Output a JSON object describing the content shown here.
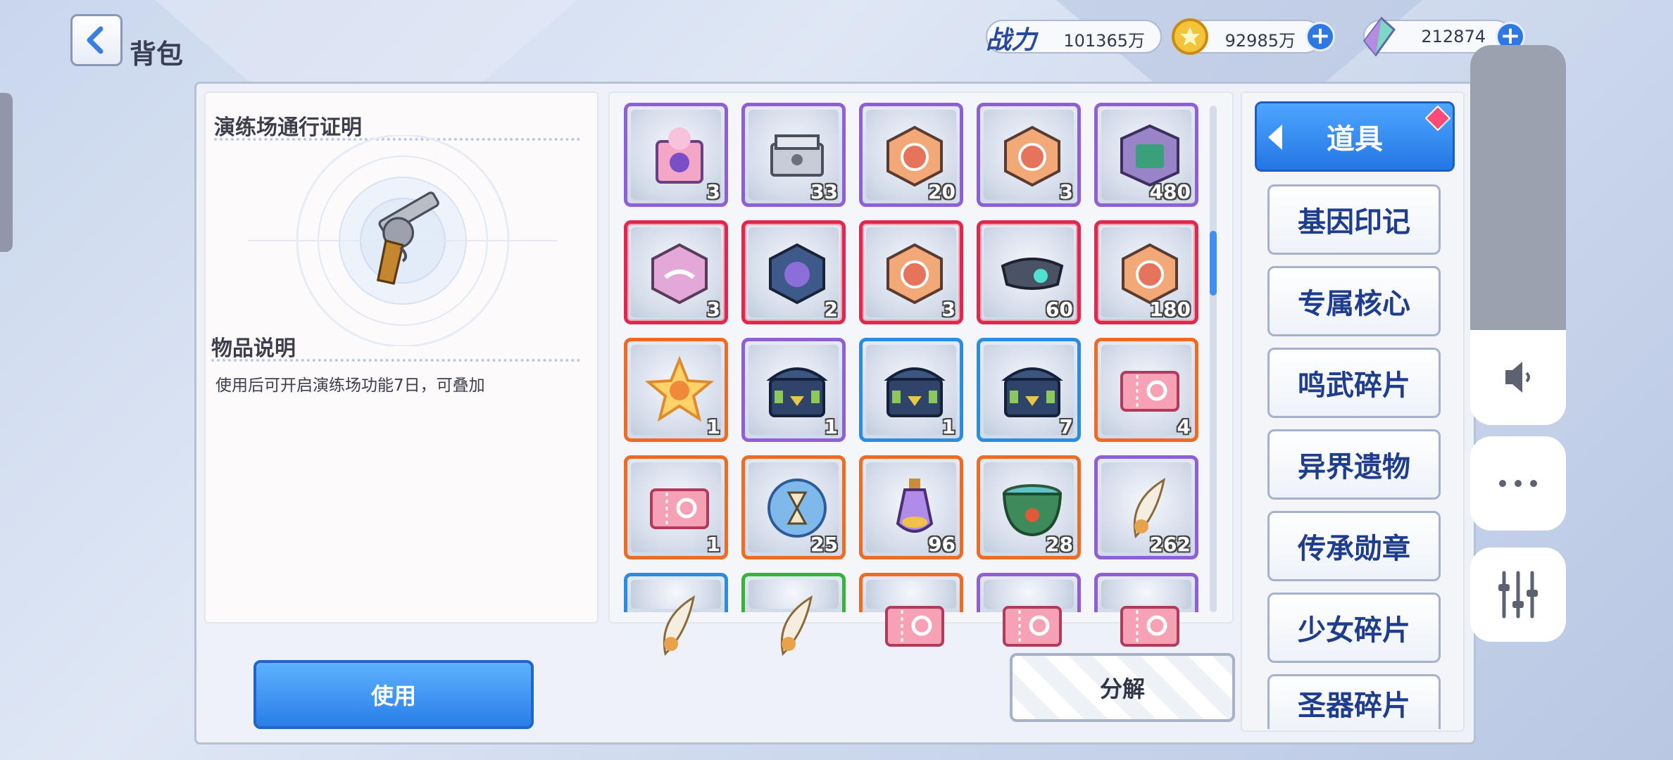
{
  "header": {
    "title": "背包",
    "power_label": "战力",
    "power_value": "101365万",
    "gold_value": "92985万",
    "gem_value": "212874"
  },
  "detail": {
    "item_name": "演练场通行证明",
    "section_label": "物品说明",
    "description": "使用后可开启演练场功能7日，可叠加"
  },
  "items": [
    {
      "count": "3",
      "rarity": "purple",
      "icon": "gift-box-icon"
    },
    {
      "count": "33",
      "rarity": "purple",
      "icon": "silver-chest-icon"
    },
    {
      "count": "20",
      "rarity": "purple",
      "icon": "orange-cube-icon"
    },
    {
      "count": "3",
      "rarity": "purple",
      "icon": "orange-cube-icon"
    },
    {
      "count": "480",
      "rarity": "purple",
      "icon": "purple-box-icon"
    },
    {
      "count": "3",
      "rarity": "red",
      "icon": "pink-cube-icon"
    },
    {
      "count": "2",
      "rarity": "red",
      "icon": "dark-cube-icon"
    },
    {
      "count": "3",
      "rarity": "red",
      "icon": "orange-cube-icon"
    },
    {
      "count": "60",
      "rarity": "red",
      "icon": "visor-icon"
    },
    {
      "count": "180",
      "rarity": "red",
      "icon": "orange-cube-icon"
    },
    {
      "count": "1",
      "rarity": "orange",
      "icon": "star-icon"
    },
    {
      "count": "1",
      "rarity": "purple",
      "icon": "navy-chest-icon"
    },
    {
      "count": "1",
      "rarity": "blue",
      "icon": "navy-chest-icon"
    },
    {
      "count": "7",
      "rarity": "blue",
      "icon": "navy-chest-icon"
    },
    {
      "count": "4",
      "rarity": "orange",
      "icon": "ticket-icon"
    },
    {
      "count": "1",
      "rarity": "orange",
      "icon": "ticket-icon"
    },
    {
      "count": "25",
      "rarity": "orange",
      "icon": "hourglass-orb-icon"
    },
    {
      "count": "96",
      "rarity": "orange",
      "icon": "potion-icon"
    },
    {
      "count": "28",
      "rarity": "orange",
      "icon": "cauldron-icon"
    },
    {
      "count": "262",
      "rarity": "purple",
      "icon": "feather-icon"
    },
    {
      "count": "",
      "rarity": "blue",
      "icon": "feather-icon"
    },
    {
      "count": "",
      "rarity": "green",
      "icon": "feather-icon"
    },
    {
      "count": "",
      "rarity": "orange",
      "icon": "ticket-icon"
    },
    {
      "count": "",
      "rarity": "purple",
      "icon": "ticket-icon"
    },
    {
      "count": "",
      "rarity": "purple",
      "icon": "ticket-icon"
    }
  ],
  "tabs": [
    {
      "label": "道具",
      "active": true
    },
    {
      "label": "基因印记"
    },
    {
      "label": "专属核心"
    },
    {
      "label": "鸣武碎片"
    },
    {
      "label": "异界遗物"
    },
    {
      "label": "传承勋章"
    },
    {
      "label": "少女碎片"
    },
    {
      "label": "圣器碎片"
    }
  ],
  "buttons": {
    "use": "使用",
    "decompose": "分解"
  },
  "colors": {
    "accent_blue": "#2f78e4",
    "rarity_purple": "#8f5fd8",
    "rarity_red": "#e0284f",
    "rarity_orange": "#ef6a22",
    "rarity_blue": "#2c8de0",
    "rarity_green": "#39b43b"
  },
  "system_controls": {
    "volume_level": 0.75
  }
}
